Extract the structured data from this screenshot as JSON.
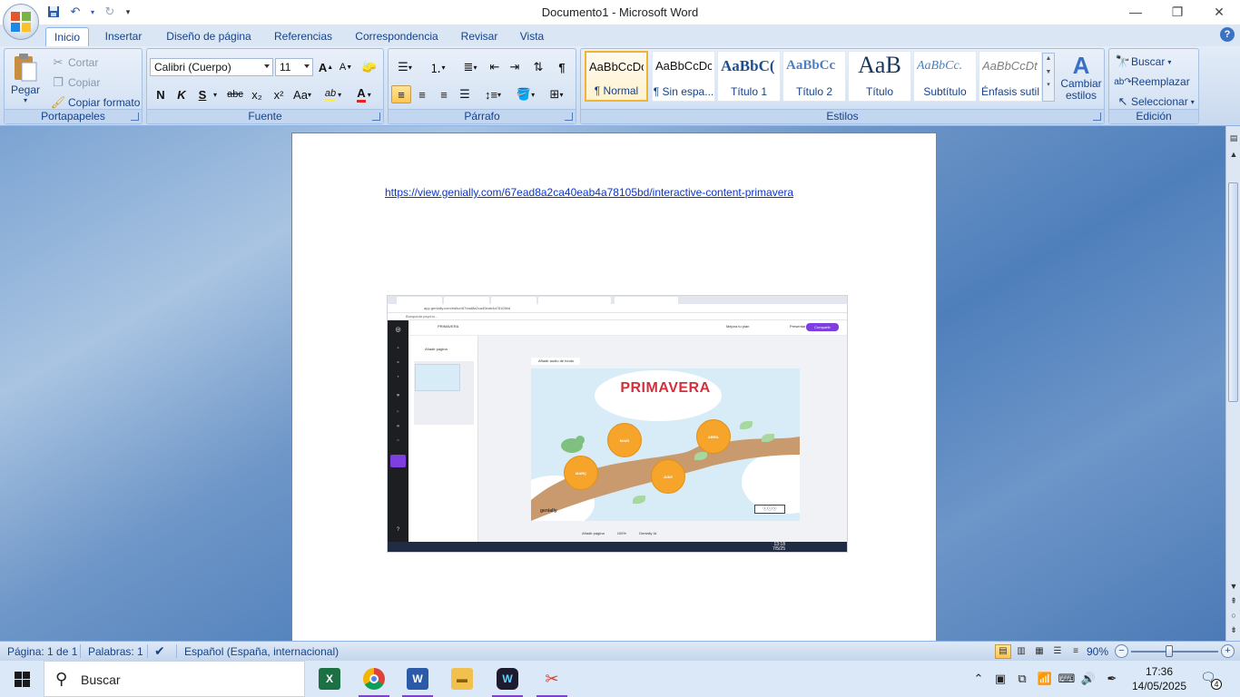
{
  "window": {
    "title": "Documento1 - Microsoft Word",
    "minimize": "—",
    "restore": "❐",
    "close": "✕"
  },
  "tabs": [
    "Inicio",
    "Insertar",
    "Diseño de página",
    "Referencias",
    "Correspondencia",
    "Revisar",
    "Vista"
  ],
  "ribbon": {
    "clipboard": {
      "label": "Portapapeles",
      "paste": "Pegar",
      "cut": "Cortar",
      "copy": "Copiar",
      "format_painter": "Copiar formato"
    },
    "font": {
      "label": "Fuente",
      "font_name": "Calibri (Cuerpo)",
      "font_size": "11",
      "bold": "N",
      "italic": "K",
      "underline": "S",
      "strike": "abc",
      "subscript": "x₂",
      "superscript": "x²",
      "change_case": "Aa",
      "grow": "A",
      "shrink": "A",
      "font_color": "A",
      "highlight": "ab"
    },
    "paragraph": {
      "label": "Párrafo",
      "pilcrow": "¶"
    },
    "styles": {
      "label": "Estilos",
      "items": [
        {
          "sample": "AaBbCcDc",
          "name": "¶ Normal"
        },
        {
          "sample": "AaBbCcDc",
          "name": "¶ Sin espa..."
        },
        {
          "sample": "AaBbC(",
          "name": "Título 1"
        },
        {
          "sample": "AaBbCc",
          "name": "Título 2"
        },
        {
          "sample": "AaB",
          "name": "Título"
        },
        {
          "sample": "AaBbCc.",
          "name": "Subtítulo"
        },
        {
          "sample": "AaBbCcDt",
          "name": "Énfasis sutil"
        }
      ],
      "change_styles": "Cambiar estilos"
    },
    "editing": {
      "label": "Edición",
      "find": "Buscar",
      "replace": "Reemplazar",
      "select": "Seleccionar"
    }
  },
  "document": {
    "link": "https://view.genially.com/67ead8a2ca40eab4a78105bd/interactive-content-primavera",
    "embedded_screenshot": {
      "url": "app.genially.com/editor/67ead8a2ca40eab4a78105bd",
      "bookmark": "Búsqueda psycho...",
      "project_name": "PRIMAVERA",
      "add_page": "Añadir página",
      "add_audio": "Añadir audio de fondo",
      "improve_plan": "Mejora tu plan",
      "present": "Presentar",
      "share": "Compartir",
      "slide_title": "PRIMAVERA",
      "brand": "genially",
      "months": [
        "MARÇ",
        "ABRIL",
        "MAIG",
        "JUNY"
      ],
      "time": "13:18",
      "date": "7/5/25",
      "zoom": "100%",
      "genially_ia": "Genially IA"
    }
  },
  "status": {
    "page": "Página: 1 de 1",
    "words": "Palabras: 1",
    "language": "Español (España, internacional)",
    "zoom": "90%"
  },
  "taskbar": {
    "search_placeholder": "Buscar",
    "time": "17:36",
    "date": "14/05/2025",
    "notifications": "4"
  }
}
